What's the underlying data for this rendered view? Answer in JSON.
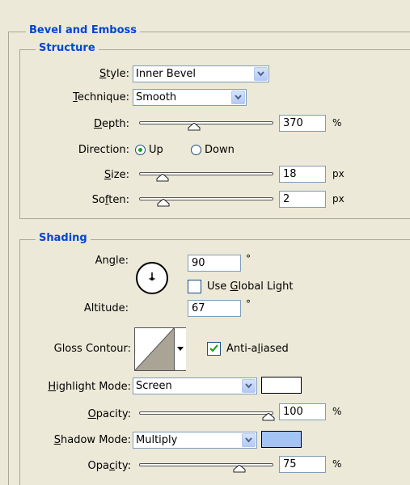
{
  "bevel_section": {
    "title": "Bevel and Emboss"
  },
  "structure": {
    "title": "Structure",
    "style": {
      "label_pre": "",
      "label_key": "S",
      "label_post": "tyle:",
      "value": "Inner Bevel"
    },
    "technique": {
      "label_pre": "",
      "label_key": "T",
      "label_post": "echnique:",
      "value": "Smooth"
    },
    "depth": {
      "label_pre": "",
      "label_key": "D",
      "label_post": "epth:",
      "value": "370",
      "unit": "%",
      "slider_fraction": 0.37
    },
    "direction": {
      "label": "Direction:",
      "up_label": "Up",
      "down_label": "Down",
      "selected": "Up"
    },
    "size": {
      "label_pre": "",
      "label_key": "S",
      "label_post": "ize:",
      "value": "18",
      "unit": "px",
      "slider_fraction": 0.1
    },
    "soften": {
      "label_pre": "So",
      "label_key": "f",
      "label_post": "ten:",
      "value": "2",
      "unit": "px",
      "slider_fraction": 0.11
    }
  },
  "shading": {
    "title": "Shading",
    "angle": {
      "label_pre": "An",
      "label_key": "g",
      "label_post": "le:",
      "value": "90",
      "unit": "°"
    },
    "use_global_light": {
      "label_pre": "Use ",
      "label_key": "G",
      "label_post": "lobal Light",
      "checked": false
    },
    "altitude": {
      "label": "Altitude:",
      "value": "67",
      "unit": "°"
    },
    "gloss_contour": {
      "label": "Gloss Contour:",
      "icon": "contour-linear-icon"
    },
    "anti_aliased": {
      "label_pre": "Anti-a",
      "label_key": "l",
      "label_post": "iased",
      "checked": true
    },
    "highlight_mode": {
      "label_pre": "",
      "label_key": "H",
      "label_post": "ighlight Mode:",
      "value": "Screen",
      "color": "#ffffff"
    },
    "highlight_opacity": {
      "label_pre": "",
      "label_key": "O",
      "label_post": "pacity:",
      "value": "100",
      "unit": "%",
      "slider_fraction": 1.0
    },
    "shadow_mode": {
      "label_pre": "",
      "label_key": "S",
      "label_post": "hadow Mode:",
      "value": "Multiply",
      "color": "#a4c4f4"
    },
    "shadow_opacity": {
      "label_pre": "Opa",
      "label_key": "c",
      "label_post": "ity:",
      "value": "75",
      "unit": "%",
      "slider_fraction": 0.75
    }
  }
}
